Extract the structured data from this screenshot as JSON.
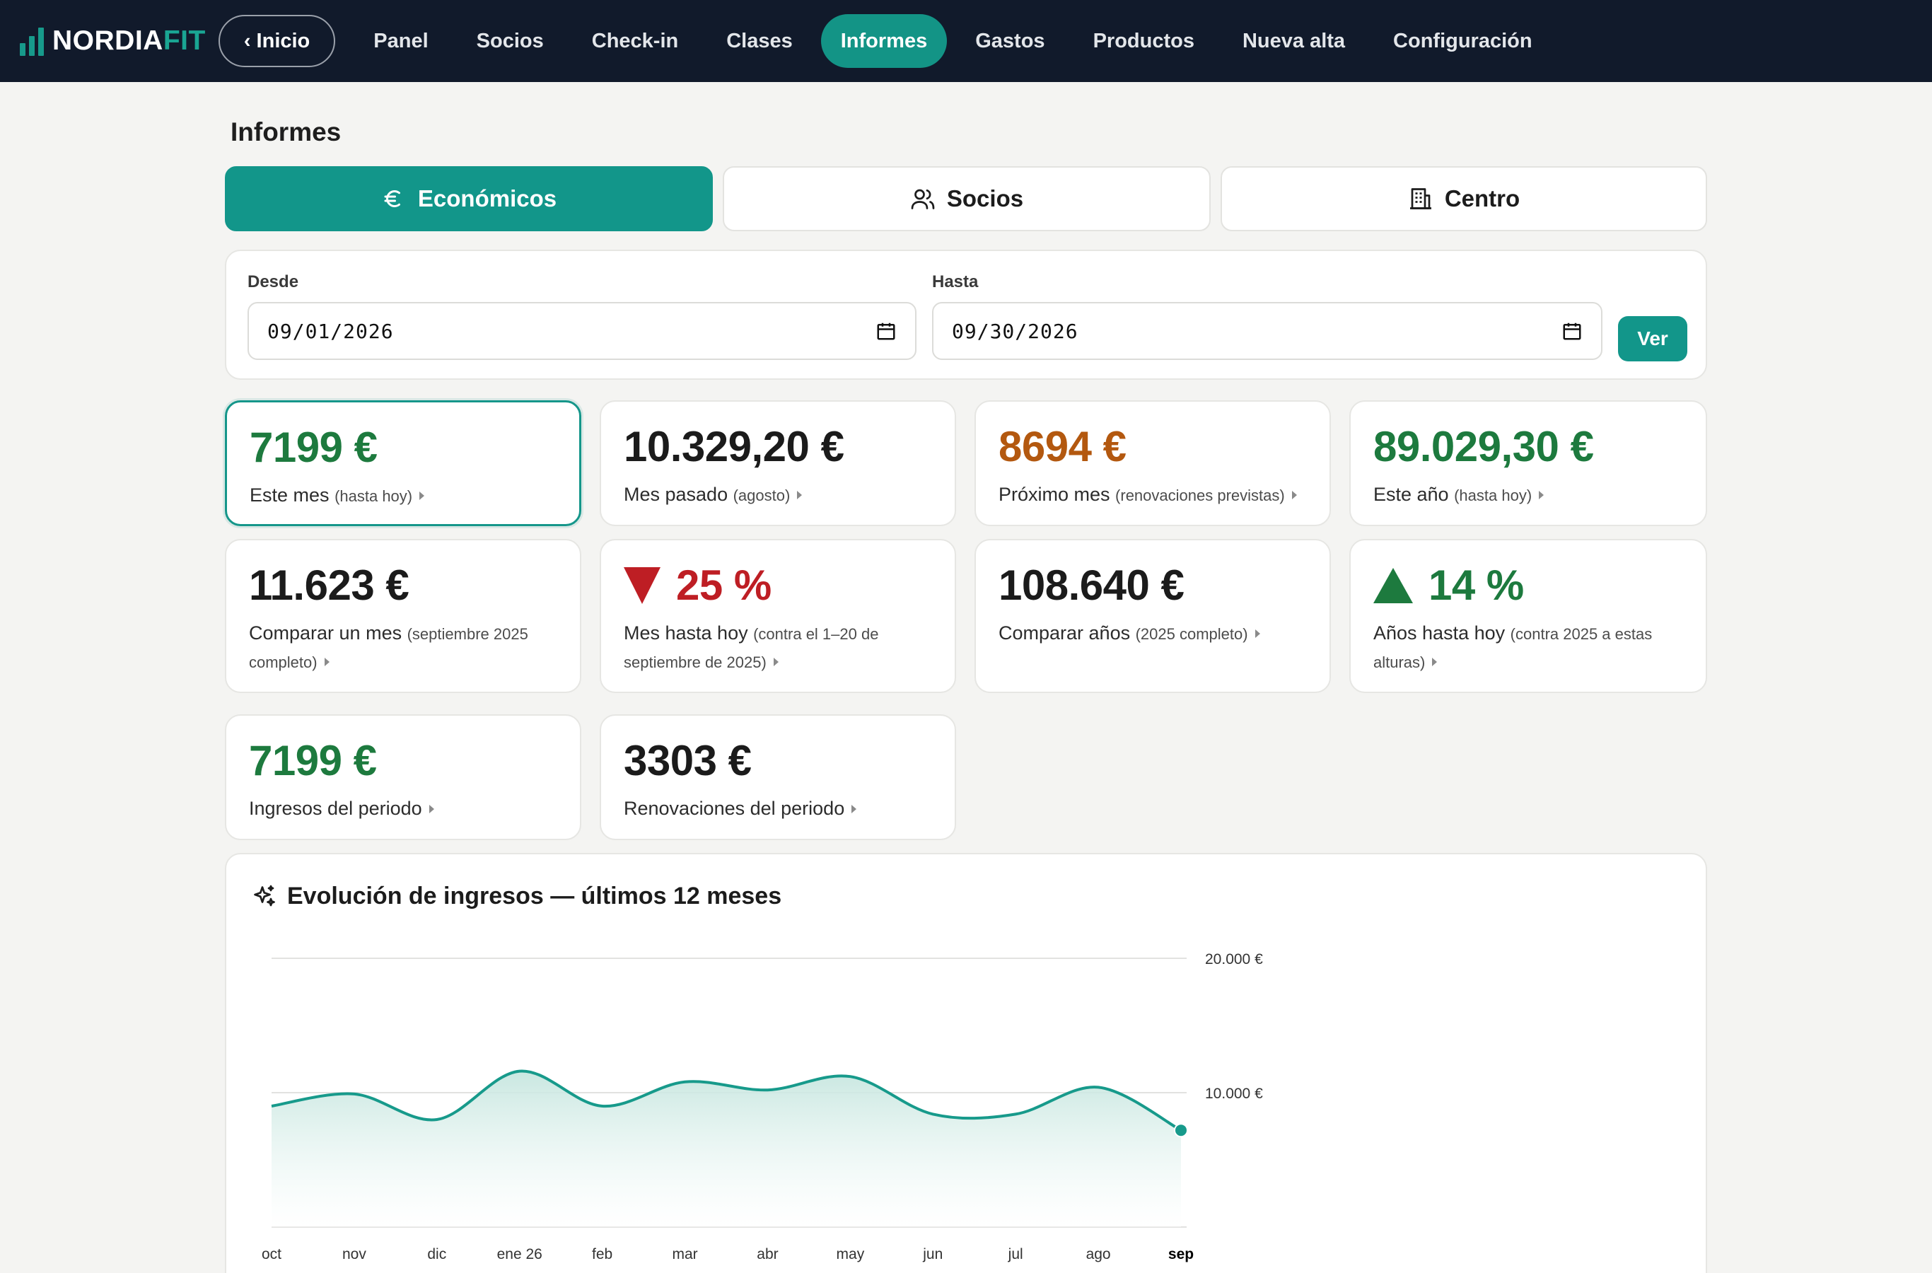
{
  "brand": {
    "part1": "NORDIA",
    "part2": "FIT"
  },
  "nav": {
    "home": "‹ Inicio",
    "items": [
      "Panel",
      "Socios",
      "Check-in",
      "Clases",
      "Informes",
      "Gastos",
      "Productos",
      "Nueva alta",
      "Configuración"
    ],
    "active": "Informes"
  },
  "page": {
    "title": "Informes"
  },
  "tabs": [
    {
      "label": "Económicos",
      "icon": "euro-icon",
      "active": true
    },
    {
      "label": "Socios",
      "icon": "users-icon",
      "active": false
    },
    {
      "label": "Centro",
      "icon": "building-icon",
      "active": false
    }
  ],
  "filters": {
    "from_label": "Desde",
    "from_value": "09/01/2026",
    "to_label": "Hasta",
    "to_value": "09/30/2026",
    "submit": "Ver"
  },
  "stats": [
    {
      "value": "7199 €",
      "label": "Este mes",
      "sub": "(hasta hoy)",
      "color": "#1d7a3e"
    },
    {
      "value": "10.329,20 €",
      "label": "Mes pasado",
      "sub": "(agosto)",
      "color": "#1b1b1b"
    },
    {
      "value": "8694 €",
      "label": "Próximo mes",
      "sub": "(renovaciones previstas)",
      "color": "#b3580f"
    },
    {
      "value": "89.029,30 €",
      "label": "Este año",
      "sub": "(hasta hoy)",
      "color": "#1d7a3e"
    },
    {
      "value": "11.623 €",
      "label": "Comparar un mes",
      "sub": "(septiembre 2025 completo)",
      "color": "#1b1b1b"
    },
    {
      "value": "25 %",
      "label": "Mes hasta hoy",
      "sub": "(contra el 1–20 de septiembre de 2025)",
      "color": "#be1e24",
      "trend": "down"
    },
    {
      "value": "108.640 €",
      "label": "Comparar años",
      "sub": "(2025 completo)",
      "color": "#1b1b1b"
    },
    {
      "value": "14 %",
      "label": "Años hasta hoy",
      "sub": "(contra 2025 a estas alturas)",
      "color": "#1d7a3e",
      "trend": "up"
    },
    {
      "value": "7199 €",
      "label": "Ingresos del periodo",
      "sub": "",
      "color": "#1d7a3e"
    },
    {
      "value": "3303 €",
      "label": "Renovaciones del periodo",
      "sub": "",
      "color": "#1b1b1b"
    }
  ],
  "chart": {
    "title": "Evolución de ingresos — últimos 12 meses",
    "icon": "sparkles-icon"
  },
  "chart_data": {
    "type": "area",
    "title": "Evolución de ingresos — últimos 12 meses",
    "categories": [
      "oct",
      "nov",
      "dic",
      "ene 26",
      "feb",
      "mar",
      "abr",
      "may",
      "jun",
      "jul",
      "ago",
      "sep"
    ],
    "highlight_category": "sep",
    "values": [
      9000,
      9900,
      8000,
      11600,
      9000,
      10800,
      10200,
      11200,
      8400,
      8400,
      10400,
      7199
    ],
    "yticks": [
      10000,
      20000
    ],
    "ytick_labels": [
      "10.000 €",
      "20.000 €"
    ],
    "ylim": [
      0,
      20000
    ],
    "ygrid": true,
    "line_color": "#179a8b",
    "fill_color": "#cfe9e4",
    "xlabel": "",
    "ylabel": ""
  }
}
